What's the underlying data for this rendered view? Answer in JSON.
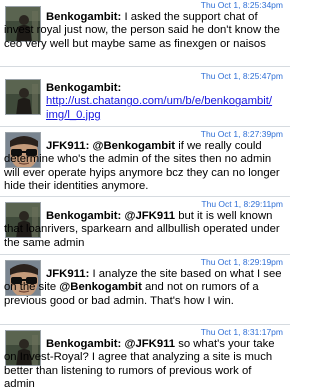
{
  "messages": [
    {
      "timestamp": "Thu Oct 1, 8:25:34pm",
      "sender": "Benkogambit:",
      "avatar": "avatar-figure-dark",
      "text": " I asked the support chat of invest royal just now, the person said he don't know the ceo very well but maybe same as finexgen or naisos"
    },
    {
      "timestamp": "Thu Oct 1, 8:25:47pm",
      "sender": "Benkogambit:",
      "avatar": "avatar-figure-dark",
      "link": "http://ust.chatango.com/um/b/e/benkogambit/img/l_0.jpg"
    },
    {
      "timestamp": "Thu Oct 1, 8:27:39pm",
      "sender": "JFK911:",
      "avatar": "avatar-sunglasses",
      "mention": "@Benkogambit",
      "text": " if we really could determine who's the admin of the sites then no admin will ever operate hyips anymore bcz they can no longer hide their identities anymore."
    },
    {
      "timestamp": "Thu Oct 1, 8:29:11pm",
      "sender": "Benkogambit:",
      "avatar": "avatar-figure-dark",
      "mention": "@JFK911",
      "text": " but it is well known that loanrivers, sparkearn and allbullish operated under the same admin"
    },
    {
      "timestamp": "Thu Oct 1, 8:29:19pm",
      "sender": "JFK911:",
      "avatar": "avatar-sunglasses",
      "text_before": " I analyze the site based on what I see on the site ",
      "mention": "@Benkogambit",
      "text": " and not on rumors of a previous good or bad admin. That's how I win."
    },
    {
      "timestamp": "Thu Oct 1, 8:31:17pm",
      "sender": "Benkogambit:",
      "avatar": "avatar-figure-dark",
      "mention": "@JFK911",
      "text": " so what's your take on Invest-Royal? I agree that analyzing a site is much better than listening to rumors of previous work of admin"
    }
  ]
}
